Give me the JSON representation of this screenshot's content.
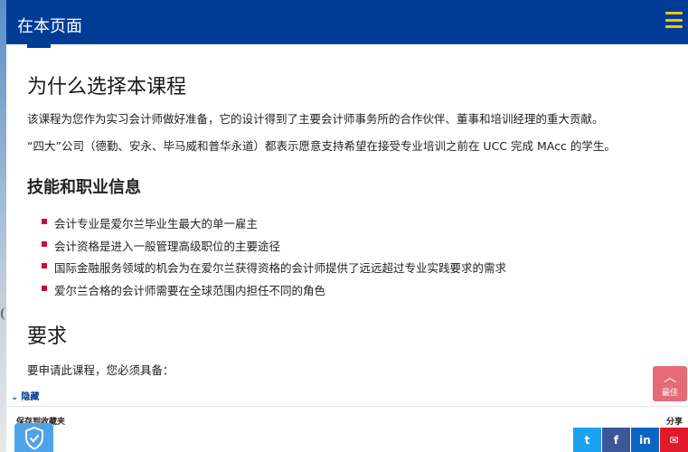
{
  "header": {
    "title": "在本页面",
    "menu_icon": "hamburger-menu-icon",
    "accent_color": "#003c96",
    "menu_color": "#f2c500"
  },
  "main": {
    "heading_why": "为什么选择本课程",
    "para_1": "该课程为您作为实习会计师做好准备，它的设计得到了主要会计师事务所的合作伙伴、董事和培训经理的重大贡献。",
    "para_2": "“四大”公司（德勤、安永、毕马威和普华永道）都表示愿意支持希望在接受专业培训之前在 UCC 完成 MAcc 的学生。",
    "heading_skills": "技能和职业信息",
    "skills": [
      "会计专业是爱尔兰毕业生最大的单一雇主",
      "会计资格是进入一般管理高级职位的主要途径",
      "国际金融服务领域的机会为在爱尔兰获得资格的会计师提供了远远超过专业实践要求的需求",
      "爱尔兰合格的会计师需要在全球范围内担任不同的角色"
    ],
    "heading_requirements": "要求",
    "para_3": "要申请此课程，您必须具备："
  },
  "controls": {
    "hide_label": "隐藏",
    "best_label": "最佳"
  },
  "footer": {
    "save_label": "保存到收藏夹",
    "share_label": "分享",
    "share_buttons": [
      {
        "icon": "twitter-icon",
        "glyph": "t"
      },
      {
        "icon": "facebook-icon",
        "glyph": "f"
      },
      {
        "icon": "linkedin-icon",
        "glyph": "in"
      },
      {
        "icon": "email-icon",
        "glyph": "✉"
      }
    ]
  }
}
